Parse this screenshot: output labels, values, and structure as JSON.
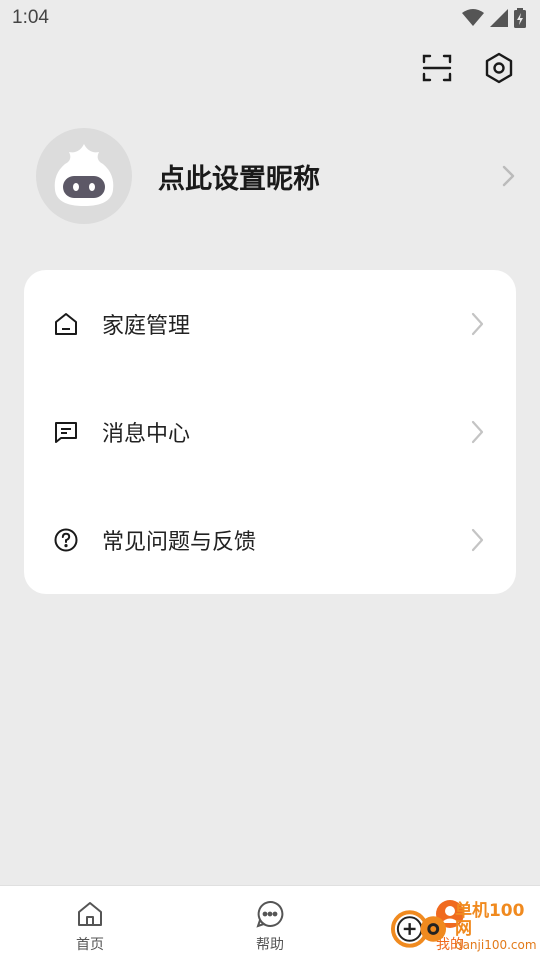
{
  "status_bar": {
    "time": "1:04"
  },
  "top_actions": {
    "scan_icon": "scan-icon",
    "settings_icon": "gear-icon"
  },
  "profile": {
    "nickname": "点此设置昵称"
  },
  "menu": {
    "items": [
      {
        "label": "家庭管理",
        "icon": "home-icon"
      },
      {
        "label": "消息中心",
        "icon": "message-icon"
      },
      {
        "label": "常见问题与反馈",
        "icon": "question-icon"
      }
    ]
  },
  "bottom_nav": {
    "items": [
      {
        "label": "首页",
        "icon": "home-icon"
      },
      {
        "label": "帮助",
        "icon": "chat-icon"
      },
      {
        "label": "我的",
        "icon": "person-icon"
      }
    ],
    "active_color": "#f06a1f"
  },
  "watermark": {
    "brand": "单机100网",
    "url": "danji100.com"
  }
}
